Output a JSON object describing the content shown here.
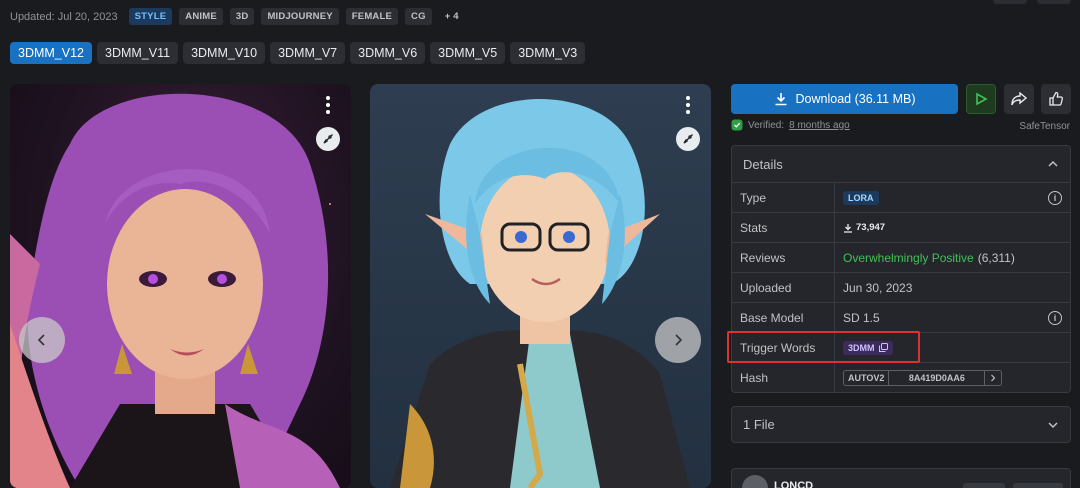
{
  "meta": {
    "updated": "Updated: Jul 20, 2023"
  },
  "tags": [
    "STYLE",
    "ANIME",
    "3D",
    "MIDJOURNEY",
    "FEMALE",
    "CG"
  ],
  "tags_more": "+ 4",
  "versions": [
    "3DMM_V12",
    "3DMM_V11",
    "3DMM_V10",
    "3DMM_V7",
    "3DMM_V6",
    "3DMM_V5",
    "3DMM_V3"
  ],
  "download": {
    "label": "Download (36.11 MB)"
  },
  "verified": {
    "prefix": "Verified:",
    "time": "8 months ago",
    "format": "SafeTensor"
  },
  "details": {
    "title": "Details",
    "type": {
      "label": "Type",
      "value": "LORA"
    },
    "stats": {
      "label": "Stats",
      "downloads": "73,947"
    },
    "reviews": {
      "label": "Reviews",
      "rating": "Overwhelmingly Positive",
      "count": "(6,311)"
    },
    "uploaded": {
      "label": "Uploaded",
      "value": "Jun 30, 2023"
    },
    "base_model": {
      "label": "Base Model",
      "value": "SD 1.5"
    },
    "trigger_words": {
      "label": "Trigger Words",
      "value": "3DMM"
    },
    "hash": {
      "label": "Hash",
      "algo": "AUTOV2",
      "value": "8A419D0AA6"
    }
  },
  "files": {
    "label": "1 File"
  },
  "creator": {
    "name": "LONCD"
  },
  "colors": {
    "accent": "#1971c2",
    "positive": "#40c057",
    "highlight": "#e03131",
    "background": "#1a1b1e"
  }
}
